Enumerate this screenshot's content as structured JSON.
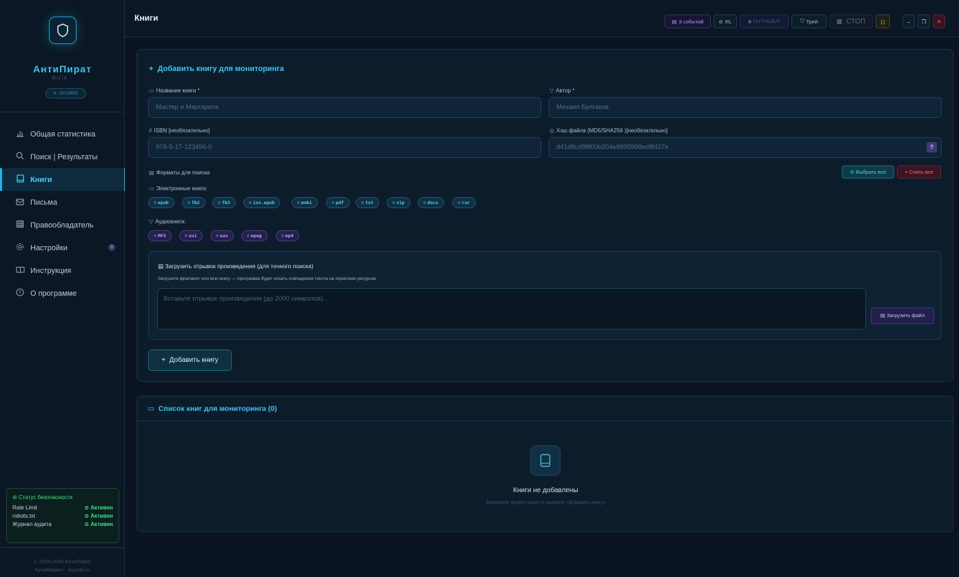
{
  "app": {
    "name": "АнтиПират",
    "build": "Build -",
    "secured": "SECURED",
    "page_title": "Книги"
  },
  "sidebar": {
    "items": [
      {
        "label": "Общая статистика",
        "icon": "bar-chart-icon"
      },
      {
        "label": "Поиск | Результаты",
        "icon": "search-icon"
      },
      {
        "label": "Книги",
        "icon": "book-icon",
        "active": true
      },
      {
        "label": "Письма",
        "icon": "mail-icon"
      },
      {
        "label": "Правообладатель",
        "icon": "building-icon"
      },
      {
        "label": "Настройки",
        "icon": "gear-icon",
        "badge": "3"
      },
      {
        "label": "Инструкция",
        "icon": "open-book-icon"
      },
      {
        "label": "О программе",
        "icon": "info-icon"
      }
    ],
    "security": {
      "title": "Статус безопасности",
      "rows": [
        {
          "name": "Rate Limit",
          "value": "Активен"
        },
        {
          "name": "robots.txt",
          "value": "Активен"
        },
        {
          "name": "Журнал аудита",
          "value": "Активен"
        }
      ]
    },
    "footer": {
      "line1": "© 2025-2026 АнтиПират",
      "line2": "КупиМаркет · buyofd.ru"
    }
  },
  "header": {
    "events": "3 событий",
    "rl": "RL",
    "hotkeys": "Ctrl+S/E/T",
    "tray": "Трей",
    "stop": "СТОП"
  },
  "form": {
    "title": "Добавить книгу для мониторинга",
    "book_label": "Название книги *",
    "book_placeholder": "Мастер и Маргарита",
    "author_label": "Автор *",
    "author_placeholder": "Михаил Булгаков",
    "isbn_label": "ISBN [необязательно]",
    "isbn_placeholder": "978-5-17-123456-0",
    "hash_label": "Хэш файла (MD5/SHA256 )[необязательно]",
    "hash_placeholder": "d41d8cd98f00b204e9800998ecf8427e",
    "hash_help": "?",
    "formats_label": "Форматы для поиска",
    "select_all": "Выбрать все",
    "clear_all": "Снять все",
    "ebooks_label": "Электронные книги:",
    "ebook_formats": [
      "epub",
      "fb2",
      "fb3",
      "ios.epub",
      "mobi",
      "pdf",
      "txt",
      "zip",
      "docx",
      "rar"
    ],
    "audio_label": "Аудиокниги:",
    "audio_formats": [
      "MP3",
      "avi",
      "wav",
      "mpeg",
      "mp4"
    ],
    "fragment_title": "Загрузить отрывок произведения (для точного поиска)",
    "fragment_sub": "Загрузите фрагмент или всю книгу — программа будет искать совпадения текста на пиратских ресурсах",
    "fragment_placeholder": "Вставьте отрывок произведения (до 2000 символов)...",
    "upload_file": "Загрузить файл",
    "add_book": "Добавить книгу"
  },
  "list": {
    "title": "Список книг для мониторинга (0)",
    "empty_title": "Книги не добавлены",
    "empty_sub": "Заполните форму выше и нажмите «Добавить книгу»"
  },
  "colors": {
    "accent": "#36c6f0",
    "success": "#3ee08a",
    "danger": "#ff6c7c",
    "audio": "#b6a6f5"
  }
}
